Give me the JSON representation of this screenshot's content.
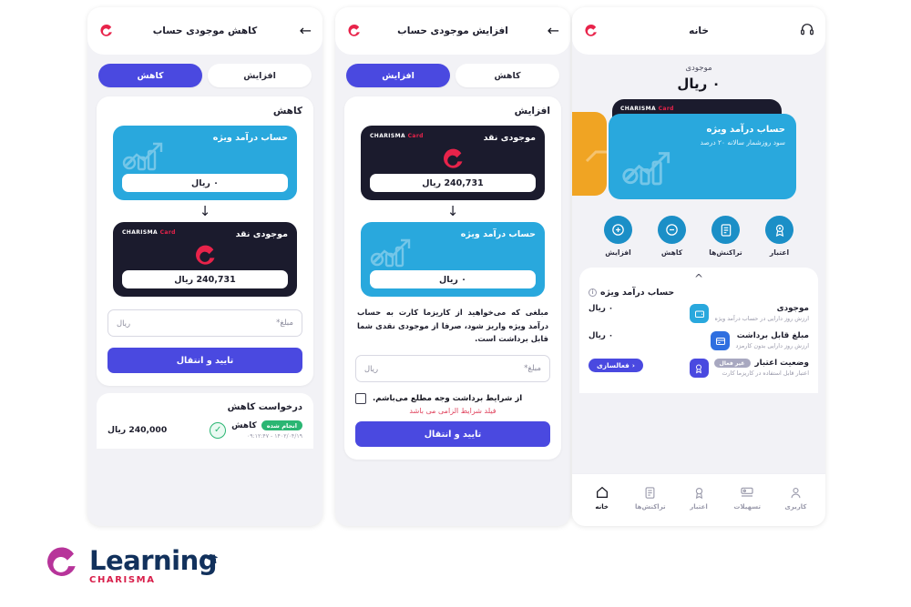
{
  "brand": {
    "accent_red": "#e8234a",
    "accent_blue": "#4a49e0",
    "accent_cyan": "#29a8dd",
    "accent_dark": "#1b1b2d",
    "accent_orange": "#f0a423",
    "logo_word": "Learning",
    "logo_sub": "CHARISMA",
    "card_logo_main": "CHARISMA",
    "card_logo_sub": "Card"
  },
  "panel1": {
    "appbar": {
      "title": "کاهش موجودی حساب",
      "back_icon": "back-arrow-icon",
      "brand_icon": "charisma-c-icon"
    },
    "tabs": [
      {
        "label": "افزایش",
        "active": false
      },
      {
        "label": "کاهش",
        "active": true
      }
    ],
    "sheet_title": "کاهش",
    "source_card": {
      "label": "حساب درآمد ویژه",
      "value": "۰ ریال"
    },
    "target_card": {
      "label": "موجودی نقد",
      "value": "240,731 ریال"
    },
    "amount_field": {
      "label": "مبلغ*",
      "unit": "ریال",
      "value": ""
    },
    "submit_label": "تایید و انتقال",
    "history": {
      "title": "درخواست کاهش",
      "rows": [
        {
          "kind": "کاهش",
          "status": "انجام شده",
          "time": "۱۴۰۲/۰۴/۱۹ - ۰۹:۱۲:۴۷",
          "amount": "240,000 ریال"
        }
      ]
    }
  },
  "panel2": {
    "appbar": {
      "title": "افزایش موجودی حساب",
      "back_icon": "back-arrow-icon",
      "brand_icon": "charisma-c-icon"
    },
    "tabs": [
      {
        "label": "افزایش",
        "active": true
      },
      {
        "label": "کاهش",
        "active": false
      }
    ],
    "sheet_title": "افزایش",
    "source_card": {
      "label": "موجودی نقد",
      "value": "240,731 ریال"
    },
    "target_card": {
      "label": "حساب درآمد ویژه",
      "value": "۰ ریال"
    },
    "note": "مبلغی که می‌خواهید از کاریزما کارت به حساب درآمد ویژه واریز شود، صرفا از موجودی نقدی شما قابل برداشت است.",
    "amount_field": {
      "label": "مبلغ*",
      "unit": "ریال",
      "value": ""
    },
    "terms_label": "از شرایط برداشت وجه مطلع می‌باشم.",
    "terms_error": "فیلد شرایط الزامی می باشد",
    "submit_label": "تایید و انتقال"
  },
  "panel3": {
    "appbar": {
      "title": "خانه",
      "support_icon": "headset-icon",
      "brand_icon": "charisma-c-icon"
    },
    "balance": {
      "label": "موجودی",
      "value": "۰ ریال"
    },
    "carousel": {
      "front_card": {
        "title": "حساب درآمد ویژه",
        "subtitle": "سود روزشمار سالانه ۲۰ درصد"
      },
      "back_card_logo": "CHARISMA Card",
      "side_card_color": "#f0a423"
    },
    "actions": [
      {
        "label": "افزایش",
        "icon": "plus-circle-icon"
      },
      {
        "label": "کاهش",
        "icon": "minus-circle-icon"
      },
      {
        "label": "تراکنش‌ها",
        "icon": "document-icon"
      },
      {
        "label": "اعتبار",
        "icon": "badge-icon"
      }
    ],
    "details": {
      "collapse_icon": "chevron-up-icon",
      "title": "حساب درآمد ویژه",
      "info_icon": "info-icon",
      "rows": [
        {
          "title": "موجودی",
          "subtitle": "ارزش روز دارایی در حساب درآمد ویژه",
          "value": "۰ ریال",
          "icon": "wallet-icon"
        },
        {
          "title": "مبلغ قابل برداشت",
          "subtitle": "ارزش روز دارایی بدون کارمزد",
          "value": "۰ ریال",
          "icon": "cash-out-icon"
        },
        {
          "title": "وضعیت اعتبار",
          "subtitle": "اعتبار قابل استفاده در کاریزما کارت",
          "badge": "غیر فعال",
          "action_label": "فعالسازی",
          "icon": "badge-icon"
        }
      ]
    },
    "bottomnav": [
      {
        "label": "خانه",
        "icon": "home-icon",
        "active": true
      },
      {
        "label": "تراکنش‌ها",
        "icon": "document-icon",
        "active": false
      },
      {
        "label": "اعتبار",
        "icon": "badge-icon",
        "active": false
      },
      {
        "label": "تسهیلات",
        "icon": "loan-icon",
        "active": false
      },
      {
        "label": "کاربری",
        "icon": "user-icon",
        "active": false
      }
    ]
  }
}
